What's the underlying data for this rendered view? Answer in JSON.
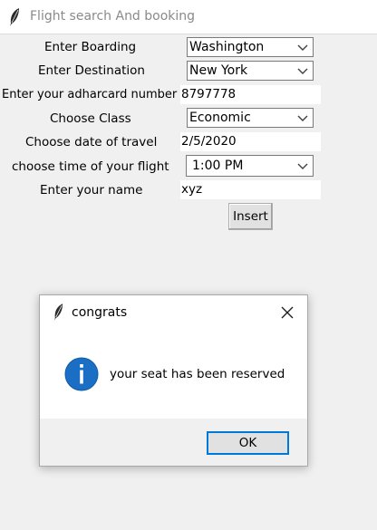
{
  "window": {
    "title": "Flight search And booking"
  },
  "form": {
    "boarding_label": "Enter Boarding",
    "boarding_value": "Washington",
    "destination_label": "Enter Destination",
    "destination_value": "New York",
    "adhar_label": "Enter your adharcard number",
    "adhar_value": "8797778",
    "class_label": "Choose Class",
    "class_value": "Economic",
    "date_label": "Choose date of travel",
    "date_value": "2/5/2020",
    "time_label": "choose time of your flight",
    "time_value": "1:00 PM",
    "name_label": "Enter your name",
    "name_value": "xyz",
    "insert_label": "Insert"
  },
  "dialog": {
    "title": "congrats",
    "message": "your seat has been reserved",
    "ok_label": "OK",
    "icon": "info-icon",
    "accent_color": "#0078d7"
  }
}
